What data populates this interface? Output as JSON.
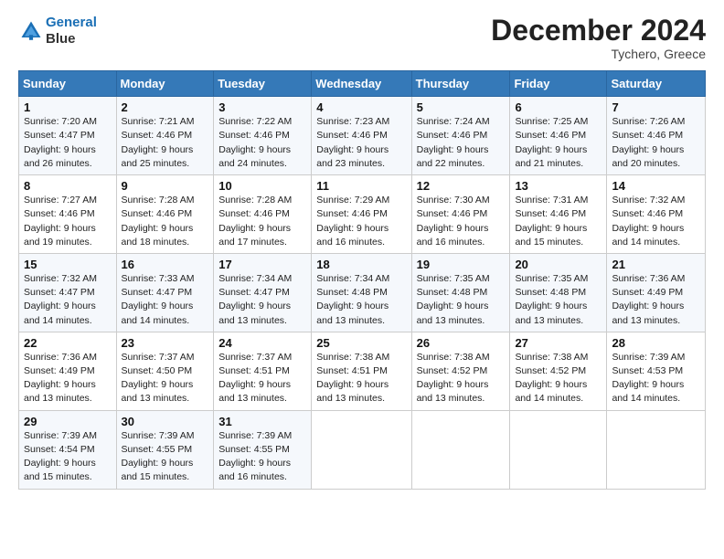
{
  "header": {
    "logo_line1": "General",
    "logo_line2": "Blue",
    "month_title": "December 2024",
    "location": "Tychero, Greece"
  },
  "weekdays": [
    "Sunday",
    "Monday",
    "Tuesday",
    "Wednesday",
    "Thursday",
    "Friday",
    "Saturday"
  ],
  "weeks": [
    [
      {
        "day": "1",
        "sunrise": "7:20 AM",
        "sunset": "4:47 PM",
        "daylight": "9 hours and 26 minutes."
      },
      {
        "day": "2",
        "sunrise": "7:21 AM",
        "sunset": "4:46 PM",
        "daylight": "9 hours and 25 minutes."
      },
      {
        "day": "3",
        "sunrise": "7:22 AM",
        "sunset": "4:46 PM",
        "daylight": "9 hours and 24 minutes."
      },
      {
        "day": "4",
        "sunrise": "7:23 AM",
        "sunset": "4:46 PM",
        "daylight": "9 hours and 23 minutes."
      },
      {
        "day": "5",
        "sunrise": "7:24 AM",
        "sunset": "4:46 PM",
        "daylight": "9 hours and 22 minutes."
      },
      {
        "day": "6",
        "sunrise": "7:25 AM",
        "sunset": "4:46 PM",
        "daylight": "9 hours and 21 minutes."
      },
      {
        "day": "7",
        "sunrise": "7:26 AM",
        "sunset": "4:46 PM",
        "daylight": "9 hours and 20 minutes."
      }
    ],
    [
      {
        "day": "8",
        "sunrise": "7:27 AM",
        "sunset": "4:46 PM",
        "daylight": "9 hours and 19 minutes."
      },
      {
        "day": "9",
        "sunrise": "7:28 AM",
        "sunset": "4:46 PM",
        "daylight": "9 hours and 18 minutes."
      },
      {
        "day": "10",
        "sunrise": "7:28 AM",
        "sunset": "4:46 PM",
        "daylight": "9 hours and 17 minutes."
      },
      {
        "day": "11",
        "sunrise": "7:29 AM",
        "sunset": "4:46 PM",
        "daylight": "9 hours and 16 minutes."
      },
      {
        "day": "12",
        "sunrise": "7:30 AM",
        "sunset": "4:46 PM",
        "daylight": "9 hours and 16 minutes."
      },
      {
        "day": "13",
        "sunrise": "7:31 AM",
        "sunset": "4:46 PM",
        "daylight": "9 hours and 15 minutes."
      },
      {
        "day": "14",
        "sunrise": "7:32 AM",
        "sunset": "4:46 PM",
        "daylight": "9 hours and 14 minutes."
      }
    ],
    [
      {
        "day": "15",
        "sunrise": "7:32 AM",
        "sunset": "4:47 PM",
        "daylight": "9 hours and 14 minutes."
      },
      {
        "day": "16",
        "sunrise": "7:33 AM",
        "sunset": "4:47 PM",
        "daylight": "9 hours and 14 minutes."
      },
      {
        "day": "17",
        "sunrise": "7:34 AM",
        "sunset": "4:47 PM",
        "daylight": "9 hours and 13 minutes."
      },
      {
        "day": "18",
        "sunrise": "7:34 AM",
        "sunset": "4:48 PM",
        "daylight": "9 hours and 13 minutes."
      },
      {
        "day": "19",
        "sunrise": "7:35 AM",
        "sunset": "4:48 PM",
        "daylight": "9 hours and 13 minutes."
      },
      {
        "day": "20",
        "sunrise": "7:35 AM",
        "sunset": "4:48 PM",
        "daylight": "9 hours and 13 minutes."
      },
      {
        "day": "21",
        "sunrise": "7:36 AM",
        "sunset": "4:49 PM",
        "daylight": "9 hours and 13 minutes."
      }
    ],
    [
      {
        "day": "22",
        "sunrise": "7:36 AM",
        "sunset": "4:49 PM",
        "daylight": "9 hours and 13 minutes."
      },
      {
        "day": "23",
        "sunrise": "7:37 AM",
        "sunset": "4:50 PM",
        "daylight": "9 hours and 13 minutes."
      },
      {
        "day": "24",
        "sunrise": "7:37 AM",
        "sunset": "4:51 PM",
        "daylight": "9 hours and 13 minutes."
      },
      {
        "day": "25",
        "sunrise": "7:38 AM",
        "sunset": "4:51 PM",
        "daylight": "9 hours and 13 minutes."
      },
      {
        "day": "26",
        "sunrise": "7:38 AM",
        "sunset": "4:52 PM",
        "daylight": "9 hours and 13 minutes."
      },
      {
        "day": "27",
        "sunrise": "7:38 AM",
        "sunset": "4:52 PM",
        "daylight": "9 hours and 14 minutes."
      },
      {
        "day": "28",
        "sunrise": "7:39 AM",
        "sunset": "4:53 PM",
        "daylight": "9 hours and 14 minutes."
      }
    ],
    [
      {
        "day": "29",
        "sunrise": "7:39 AM",
        "sunset": "4:54 PM",
        "daylight": "9 hours and 15 minutes."
      },
      {
        "day": "30",
        "sunrise": "7:39 AM",
        "sunset": "4:55 PM",
        "daylight": "9 hours and 15 minutes."
      },
      {
        "day": "31",
        "sunrise": "7:39 AM",
        "sunset": "4:55 PM",
        "daylight": "9 hours and 16 minutes."
      },
      null,
      null,
      null,
      null
    ]
  ]
}
